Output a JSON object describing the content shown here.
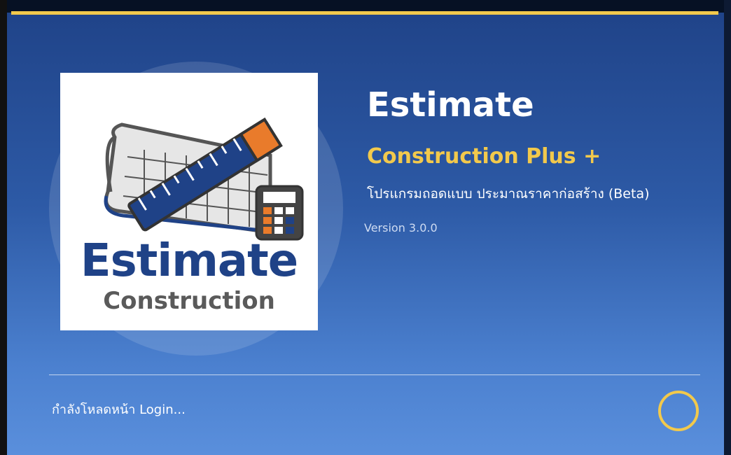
{
  "splash": {
    "logo": {
      "title": "Estimate",
      "subtitle": "Construction"
    },
    "app_title": "Estimate",
    "app_subtitle": "Construction Plus +",
    "description": "โปรแกรมถอดแบบ ประมาณราคาก่อสร้าง (Beta)",
    "version": "Version 3.0.0",
    "status": "กำลังโหลดหน้า Login...",
    "spinner_icon": "loading-spinner-icon"
  },
  "colors": {
    "accent": "#f2c94c",
    "brand_blue": "#1f4287",
    "background_top": "#1f4287",
    "background_bottom": "#5a8fdc"
  }
}
